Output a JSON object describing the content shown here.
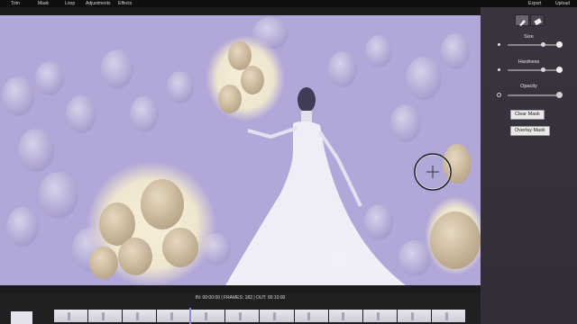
{
  "menu": {
    "trim": "Trim",
    "mask": "Mask",
    "loop": "Loop",
    "adjustments": "Adjustments",
    "effects": "Effects",
    "export": "Export",
    "upload": "Upload"
  },
  "panel": {
    "tools": [
      {
        "icon": "brush-icon",
        "active": true
      },
      {
        "icon": "eraser-icon",
        "active": false
      }
    ],
    "size": {
      "label": "Size",
      "value": 0.7
    },
    "hardness": {
      "label": "Hardness",
      "value": 0.7
    },
    "opacity": {
      "label": "Opacity",
      "value": 1.0
    },
    "clear_mask": "Clear Mask",
    "overlay_mask": "Overlay Mask"
  },
  "timeline": {
    "info": "IN: 00:00:00  |  FRAMES: 182  |  OUT: 00:10:00"
  },
  "colors": {
    "overlay": "#b1a7d8",
    "mask_highlight": "#e8dcc2",
    "panel": "#3b3440"
  }
}
